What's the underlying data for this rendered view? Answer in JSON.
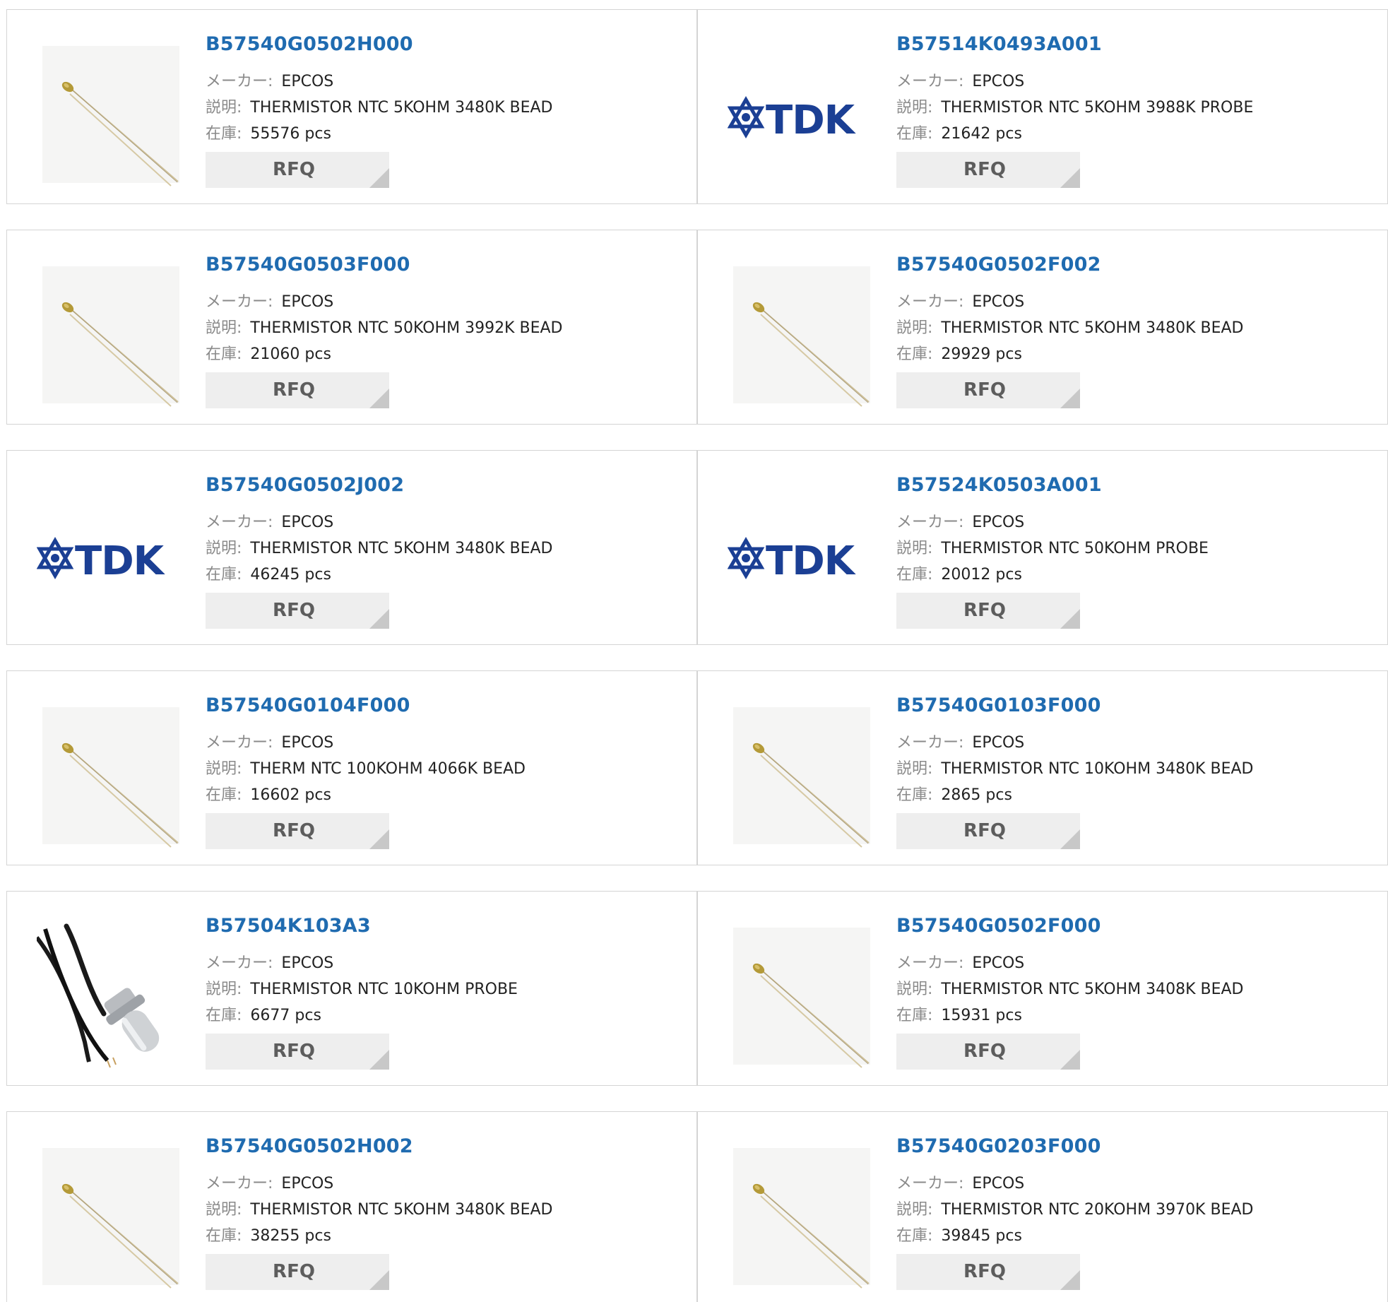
{
  "labels": {
    "maker": "メーカー:",
    "desc": "説明:",
    "stock": "在庫:",
    "rfq": "RFQ"
  },
  "products": [
    {
      "pn": "B57540G0502H000",
      "maker": "EPCOS",
      "desc": "THERMISTOR NTC 5KOHM 3480K BEAD",
      "stock": "55576 pcs",
      "image": "thermistor-bead"
    },
    {
      "pn": "B57514K0493A001",
      "maker": "EPCOS",
      "desc": "THERMISTOR NTC 5KOHM 3988K PROBE",
      "stock": "21642 pcs",
      "image": "tdk-logo",
      "logo_text": "TDK"
    },
    {
      "pn": "B57540G0503F000",
      "maker": "EPCOS",
      "desc": "THERMISTOR NTC 50KOHM 3992K BEAD",
      "stock": "21060 pcs",
      "image": "thermistor-bead"
    },
    {
      "pn": "B57540G0502F002",
      "maker": "EPCOS",
      "desc": "THERMISTOR NTC 5KOHM 3480K BEAD",
      "stock": "29929 pcs",
      "image": "thermistor-bead"
    },
    {
      "pn": "B57540G0502J002",
      "maker": "EPCOS",
      "desc": "THERMISTOR NTC 5KOHM 3480K BEAD",
      "stock": "46245 pcs",
      "image": "tdk-logo",
      "logo_text": "TDK"
    },
    {
      "pn": "B57524K0503A001",
      "maker": "EPCOS",
      "desc": "THERMISTOR NTC 50KOHM PROBE",
      "stock": "20012 pcs",
      "image": "tdk-logo",
      "logo_text": "TDK"
    },
    {
      "pn": "B57540G0104F000",
      "maker": "EPCOS",
      "desc": "THERM NTC 100KOHM 4066K BEAD",
      "stock": "16602 pcs",
      "image": "thermistor-bead"
    },
    {
      "pn": "B57540G0103F000",
      "maker": "EPCOS",
      "desc": "THERMISTOR NTC 10KOHM 3480K BEAD",
      "stock": "2865 pcs",
      "image": "thermistor-bead"
    },
    {
      "pn": "B57504K103A3",
      "maker": "EPCOS",
      "desc": "THERMISTOR NTC 10KOHM PROBE",
      "stock": "6677 pcs",
      "image": "thermistor-probe"
    },
    {
      "pn": "B57540G0502F000",
      "maker": "EPCOS",
      "desc": "THERMISTOR NTC 5KOHM 3408K BEAD",
      "stock": "15931 pcs",
      "image": "thermistor-bead"
    },
    {
      "pn": "B57540G0502H002",
      "maker": "EPCOS",
      "desc": "THERMISTOR NTC 5KOHM 3480K BEAD",
      "stock": "38255 pcs",
      "image": "thermistor-bead"
    },
    {
      "pn": "B57540G0203F000",
      "maker": "EPCOS",
      "desc": "THERMISTOR NTC 20KOHM 3970K BEAD",
      "stock": "39845 pcs",
      "image": "thermistor-bead"
    }
  ],
  "colors": {
    "link": "#1f6bb0",
    "logo": "#1b3f94",
    "border": "#d4d4d4",
    "button_bg": "#eeeeee"
  }
}
